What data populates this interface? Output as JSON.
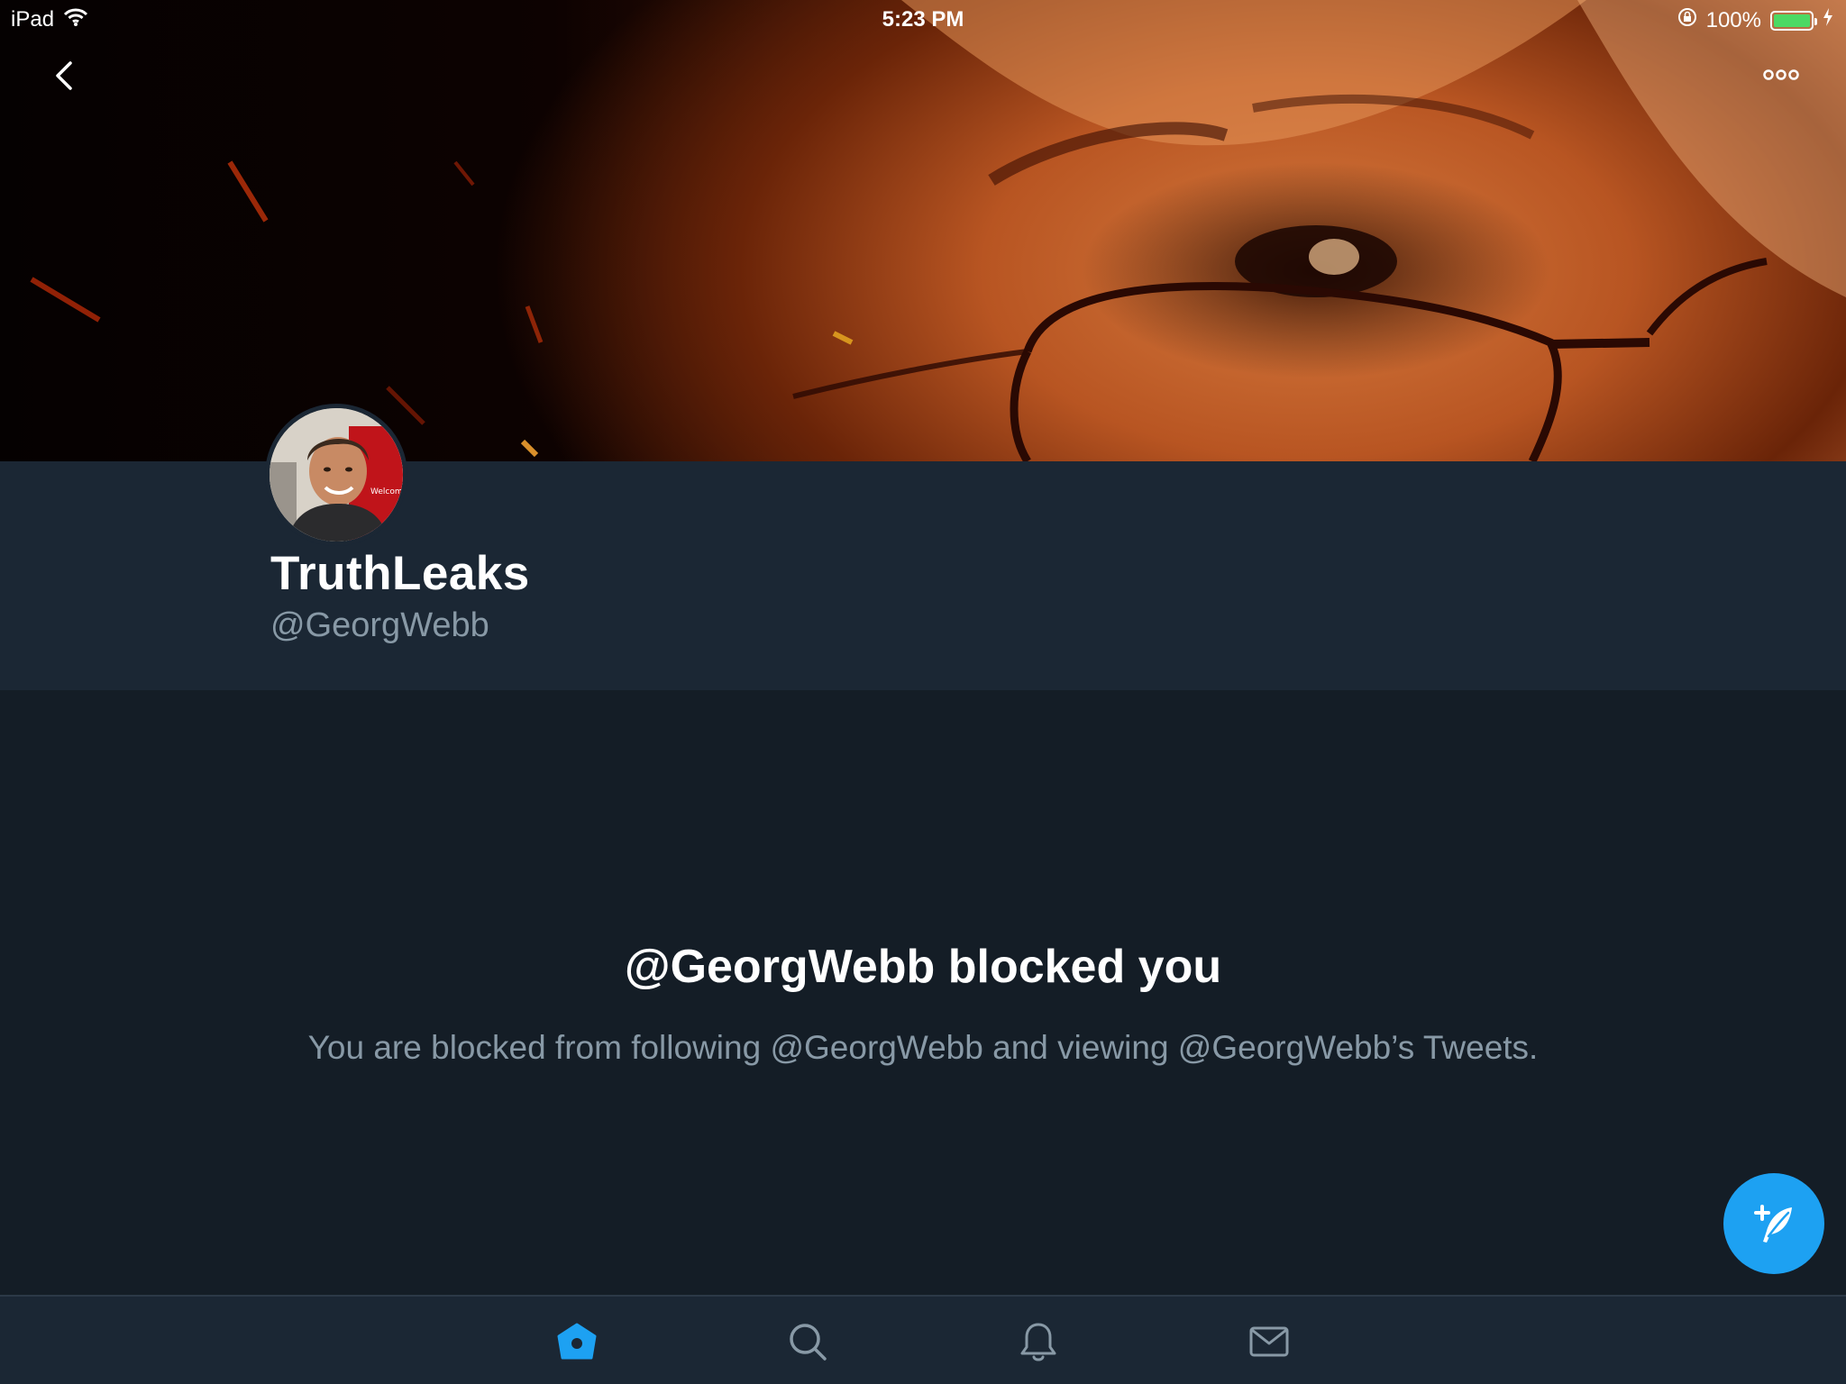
{
  "status_bar": {
    "device": "iPad",
    "time": "5:23 PM",
    "battery": "100%",
    "battery_level": 1.0,
    "battery_color": "#4cd964"
  },
  "nav": {
    "back_icon": "chevron-left-icon",
    "more_icon": "more-horizontal-icon"
  },
  "profile": {
    "display_name": "TruthLeaks",
    "screen_name": "@GeorgWebb"
  },
  "blocked": {
    "title": "@GeorgWebb blocked you",
    "message": "You are blocked from following @GeorgWebb and viewing @GeorgWebb’s Tweets."
  },
  "compose": {
    "icon": "compose-feather-icon",
    "color": "#1da1f2"
  },
  "tab_bar": {
    "tabs": [
      {
        "name": "home",
        "icon": "home-icon",
        "active": true
      },
      {
        "name": "search",
        "icon": "search-icon",
        "active": false
      },
      {
        "name": "notifications",
        "icon": "bell-icon",
        "active": false
      },
      {
        "name": "messages",
        "icon": "envelope-icon",
        "active": false
      }
    ],
    "active_color": "#1da1f2",
    "inactive_color": "#8899a6"
  },
  "colors": {
    "background": "#141d26",
    "header_background": "#1b2734",
    "secondary_text": "#8899a6"
  }
}
